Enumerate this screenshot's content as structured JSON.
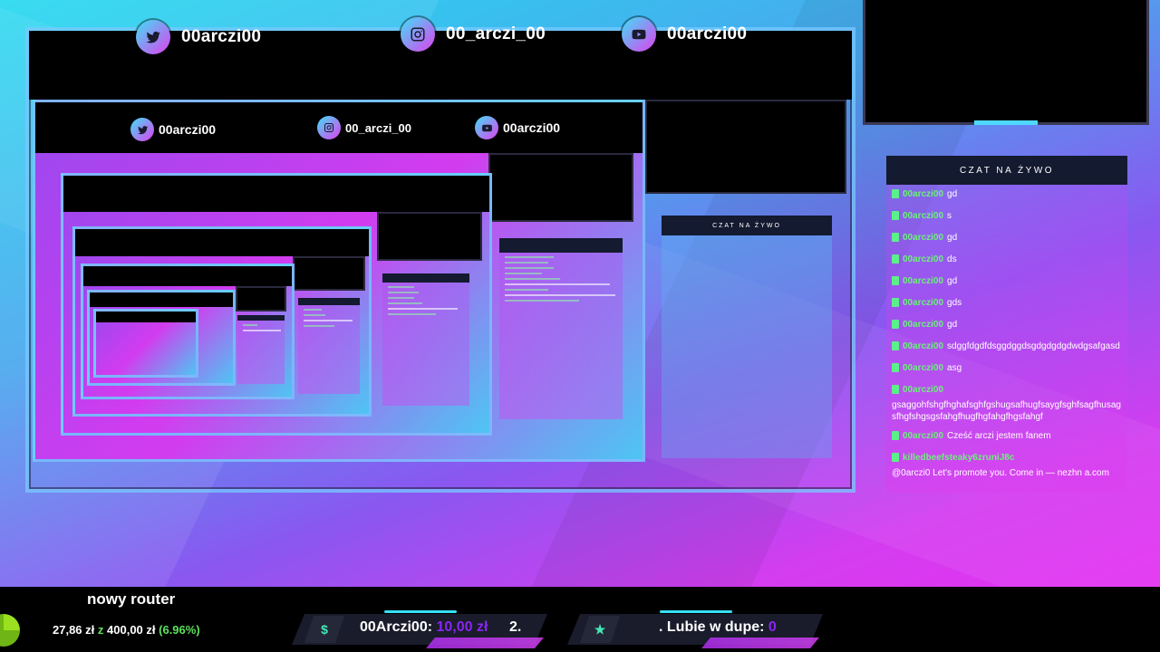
{
  "socials": [
    {
      "platform": "twitter",
      "icon": "twitter-icon",
      "handle": "00arczi00"
    },
    {
      "platform": "instagram",
      "icon": "instagram-icon",
      "handle": "00_arczi_00"
    },
    {
      "platform": "youtube",
      "icon": "youtube-icon",
      "handle": "00arczi00"
    }
  ],
  "chat": {
    "title": "CZAT NA ŻYWO",
    "messages": [
      {
        "user": "00arczi00",
        "text": "gd"
      },
      {
        "user": "00arczi00",
        "text": "s"
      },
      {
        "user": "00arczi00",
        "text": "gd"
      },
      {
        "user": "00arczi00",
        "text": "ds"
      },
      {
        "user": "00arczi00",
        "text": "gd"
      },
      {
        "user": "00arczi00",
        "text": "gds"
      },
      {
        "user": "00arczi00",
        "text": "gd"
      },
      {
        "user": "00arczi00",
        "text": "sdggfdgdfdsggdggdsgdgdgdgdwdgsafgasd"
      },
      {
        "user": "00arczi00",
        "text": "asg"
      },
      {
        "user": "00arczi00",
        "text": "gsaggohfshgfhghafsghfgshugsafhugfsaygfsghfsagfhusagsfhgfshgsgsfahgfhugfhgfahgfhgsfahgf"
      },
      {
        "user": "00arczi00",
        "text": "Cześć arczi jestem fanem"
      },
      {
        "user": "killedbeefsteaky6zruniJ8c",
        "text": "@0arczi0 Let's promote you. Come in — nezhn a.com"
      }
    ]
  },
  "goal": {
    "title": "nowy router",
    "current": "27,86 zł",
    "sep": "z",
    "target": "400,00 zł",
    "percent": "(6.96%)"
  },
  "alerts": [
    {
      "icon": "dollar-icon",
      "glyph": "$",
      "name": "00Arczi00:",
      "amount": "10,00 zł",
      "rank": "2."
    },
    {
      "icon": "star-icon",
      "glyph": "★",
      "name": ". Lubie w dupe:",
      "amount": "0",
      "rank": ""
    }
  ],
  "colors": {
    "accent_cyan": "#36e0f5",
    "chat_user": "#6cf07a",
    "amount": "#8a25f0"
  }
}
